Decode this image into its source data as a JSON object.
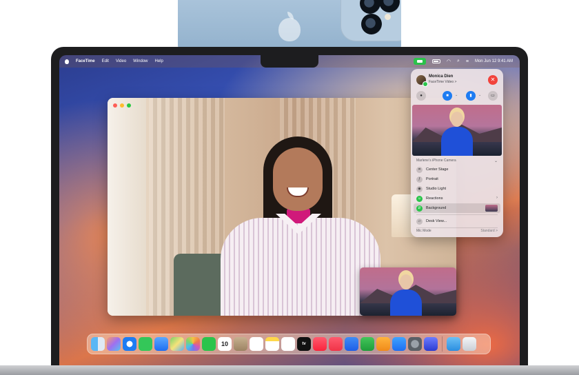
{
  "menubar": {
    "app_name": "FaceTime",
    "menus": [
      "Edit",
      "Video",
      "Window",
      "Help"
    ],
    "clock": "Mon Jun 12 9:41 AM"
  },
  "control_center": {
    "caller_name": "Monica Dien",
    "caller_subtitle": "FaceTime Video >",
    "end_icon": "close-icon",
    "section_title": "Marlene’s iPhone Camera",
    "items": [
      {
        "label": "Center Stage",
        "icon": "center-stage-icon"
      },
      {
        "label": "Portrait",
        "icon": "portrait-icon"
      },
      {
        "label": "Studio Light",
        "icon": "studio-light-icon"
      },
      {
        "label": "Reactions",
        "icon": "reactions-icon"
      },
      {
        "label": "Background",
        "icon": "background-icon"
      },
      {
        "label": "Desk View...",
        "icon": "desk-view-icon"
      }
    ],
    "mic_mode_label": "Mic Mode",
    "mic_mode_value": "Standard >"
  },
  "dock": {
    "calendar_day": "10",
    "tv_label": "tv",
    "apps": [
      "finder",
      "launchpad",
      "safari",
      "messages",
      "mail",
      "maps",
      "photos",
      "facetime",
      "calendar",
      "contacts",
      "reminders",
      "notes",
      "freeform",
      "tv",
      "music",
      "news",
      "keynote",
      "numbers",
      "pages",
      "app-store",
      "system-settings",
      "iphone-mirroring",
      "downloads",
      "trash"
    ]
  },
  "colors": {
    "accent_blue": "#1e7cf2",
    "facetime_green": "#2bc44b",
    "end_call_red": "#f2433c"
  }
}
